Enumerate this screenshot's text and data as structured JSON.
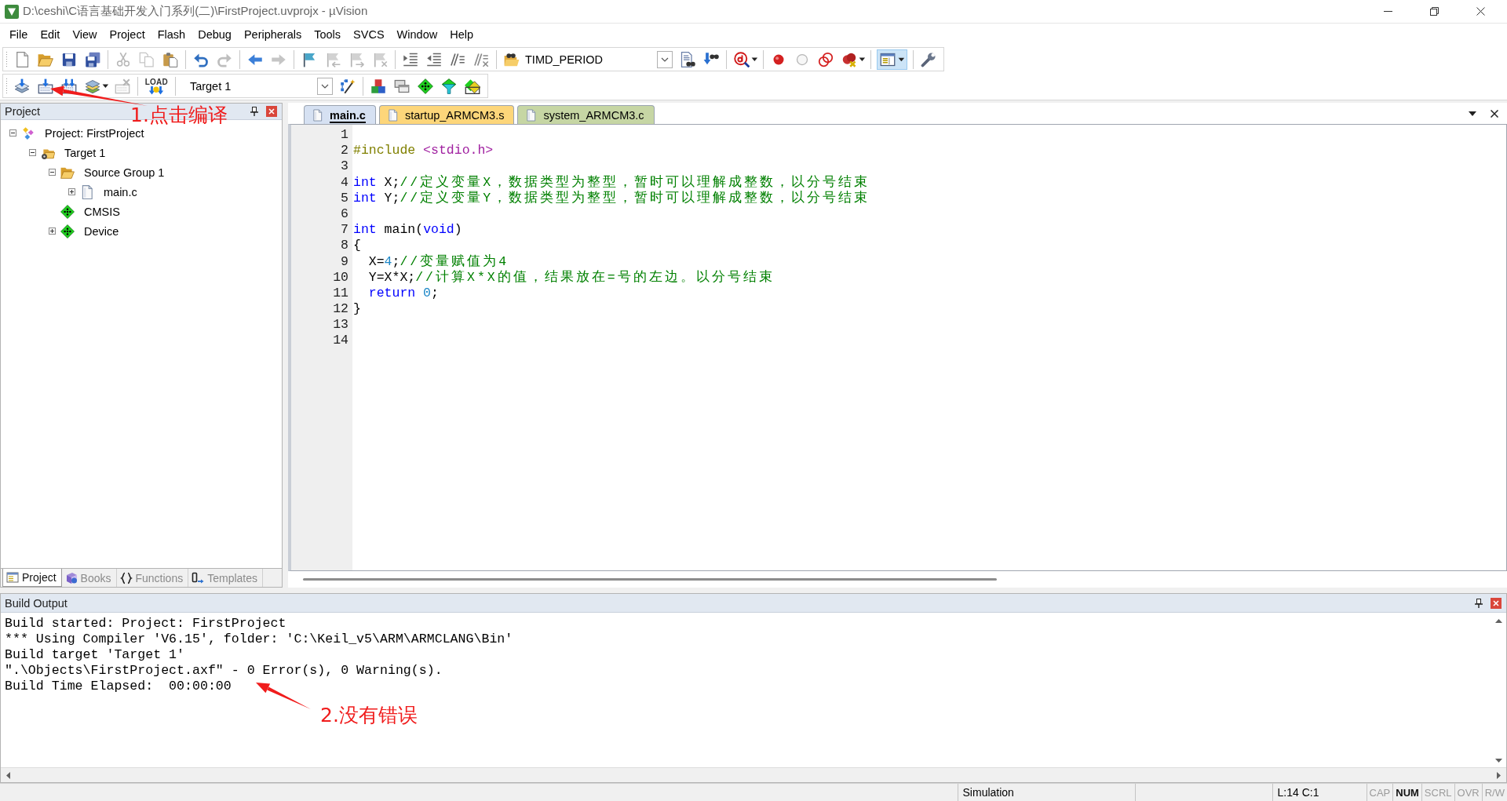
{
  "window": {
    "title": "D:\\ceshi\\C语言基础开发入门系列(二)\\FirstProject.uvprojx - µVision"
  },
  "menu": [
    "File",
    "Edit",
    "View",
    "Project",
    "Flash",
    "Debug",
    "Peripherals",
    "Tools",
    "SVCS",
    "Window",
    "Help"
  ],
  "toolbar_1": [
    {
      "kind": "new",
      "disabled": false,
      "on": false
    },
    {
      "kind": "open",
      "disabled": false,
      "on": false
    },
    {
      "kind": "save",
      "disabled": false,
      "on": false
    },
    {
      "kind": "saveall",
      "disabled": false,
      "on": false
    },
    {
      "kind": "separator"
    },
    {
      "kind": "cut",
      "disabled": true,
      "on": false
    },
    {
      "kind": "copy",
      "disabled": true,
      "on": false
    },
    {
      "kind": "paste",
      "disabled": false,
      "on": false
    },
    {
      "kind": "separator"
    },
    {
      "kind": "undo",
      "disabled": false,
      "on": false
    },
    {
      "kind": "redo",
      "disabled": true,
      "on": false
    },
    {
      "kind": "separator"
    },
    {
      "kind": "back",
      "disabled": false,
      "on": false
    },
    {
      "kind": "forward",
      "disabled": true,
      "on": false
    },
    {
      "kind": "separator"
    },
    {
      "kind": "bookmark",
      "disabled": false,
      "on": false
    },
    {
      "kind": "prevmark",
      "disabled": true,
      "on": false
    },
    {
      "kind": "nextmark",
      "disabled": true,
      "on": false
    },
    {
      "kind": "clearmarks",
      "disabled": true,
      "on": false
    },
    {
      "kind": "separator"
    },
    {
      "kind": "indent",
      "disabled": false,
      "on": false
    },
    {
      "kind": "unindent",
      "disabled": false,
      "on": false
    },
    {
      "kind": "comment",
      "disabled": false,
      "on": false
    },
    {
      "kind": "uncomment",
      "disabled": false,
      "on": false
    },
    {
      "kind": "separator"
    },
    {
      "kind": "findfiles",
      "disabled": false,
      "on": false
    },
    {
      "kind": "combo",
      "value": "TIMD_PERIOD"
    },
    {
      "kind": "find",
      "disabled": false,
      "on": false
    },
    {
      "kind": "incfind",
      "disabled": false,
      "on": false
    },
    {
      "kind": "separator"
    },
    {
      "kind": "debug",
      "disabled": false,
      "on": false
    },
    {
      "kind": "caret",
      "disabled": false,
      "on": false
    },
    {
      "kind": "separator"
    },
    {
      "kind": "breakpoint",
      "disabled": false,
      "on": false
    },
    {
      "kind": "bpdisable",
      "disabled": false,
      "on": false
    },
    {
      "kind": "bpdisableall",
      "disabled": false,
      "on": false
    },
    {
      "kind": "bpkill",
      "disabled": false,
      "on": false
    },
    {
      "kind": "caret",
      "disabled": false,
      "on": false
    },
    {
      "kind": "separator"
    },
    {
      "kind": "layout",
      "disabled": false,
      "on": true
    },
    {
      "kind": "separator"
    },
    {
      "kind": "wrench",
      "disabled": false,
      "on": false
    }
  ],
  "toolbar_2": [
    {
      "kind": "translate",
      "disabled": false,
      "on": false
    },
    {
      "kind": "build",
      "disabled": false,
      "on": false
    },
    {
      "kind": "rebuild",
      "disabled": false,
      "on": false
    },
    {
      "kind": "batch",
      "disabled": false,
      "on": false
    },
    {
      "kind": "caret",
      "disabled": false,
      "on": false
    },
    {
      "kind": "stopbuild",
      "disabled": true,
      "on": false
    },
    {
      "kind": "separator"
    },
    {
      "kind": "load",
      "label": "LOAD",
      "disabled": false,
      "on": false
    },
    {
      "kind": "separator"
    },
    {
      "kind": "combo",
      "value": "Target 1"
    },
    {
      "kind": "wand",
      "disabled": false,
      "on": false
    },
    {
      "kind": "separator"
    },
    {
      "kind": "manage",
      "disabled": false,
      "on": false
    },
    {
      "kind": "windows",
      "disabled": false,
      "on": false
    },
    {
      "kind": "rte",
      "disabled": false,
      "on": false
    },
    {
      "kind": "funnel",
      "disabled": false,
      "on": false
    },
    {
      "kind": "packinstaller",
      "disabled": false,
      "on": false
    }
  ],
  "project_panel": {
    "title": "Project",
    "tree": [
      {
        "label": "Project: FirstProject",
        "kind": "project",
        "expanded": true,
        "selected": false,
        "children": [
          {
            "label": "Target 1",
            "kind": "target",
            "expanded": true,
            "selected": false,
            "children": [
              {
                "label": "Source Group 1",
                "kind": "folder",
                "expanded": true,
                "selected": false,
                "children": [
                  {
                    "label": "main.c",
                    "kind": "file",
                    "expanded": false,
                    "selected": false
                  }
                ]
              },
              {
                "label": "CMSIS",
                "kind": "component",
                "selected": false
              },
              {
                "label": "Device",
                "kind": "component",
                "expanded": false,
                "selected": false
              }
            ]
          }
        ]
      }
    ],
    "tabs": [
      {
        "label": "Project",
        "kind": "project",
        "selected": true
      },
      {
        "label": "Books",
        "kind": "books",
        "selected": false
      },
      {
        "label": "Functions",
        "kind": "functions",
        "selected": false
      },
      {
        "label": "Templates",
        "kind": "templates",
        "selected": false
      }
    ]
  },
  "editor": {
    "tabs": [
      {
        "label": "main.c",
        "selected": true,
        "color": "#d6e1f2"
      },
      {
        "label": "startup_ARMCM3.s",
        "selected": false,
        "color": "#fdd67a"
      },
      {
        "label": "system_ARMCM3.c",
        "selected": false,
        "color": "#c6d6a4"
      }
    ],
    "lines": [
      {
        "number": "1"
      },
      {
        "number": "2",
        "tokens": [
          {
            "kind": "preprocessor",
            "text": "#include"
          },
          {
            "kind": "header",
            "text": " <stdio.h>"
          }
        ]
      },
      {
        "number": "3"
      },
      {
        "number": "4",
        "tokens": [
          {
            "kind": "keyword",
            "text": "int"
          },
          {
            "kind": "plain",
            "text": " X;"
          },
          {
            "kind": "comment",
            "text": "//定义变量X，数据类型为整型，暂时可以理解成整数，以分号结束"
          }
        ]
      },
      {
        "number": "5",
        "tokens": [
          {
            "kind": "keyword",
            "text": "int"
          },
          {
            "kind": "plain",
            "text": " Y;"
          },
          {
            "kind": "comment",
            "text": "//定义变量Y，数据类型为整型，暂时可以理解成整数，以分号结束"
          }
        ]
      },
      {
        "number": "6"
      },
      {
        "number": "7",
        "tokens": [
          {
            "kind": "keyword",
            "text": "int"
          },
          {
            "kind": "plain",
            "text": " main("
          },
          {
            "kind": "keyword",
            "text": "void"
          },
          {
            "kind": "plain",
            "text": ")"
          }
        ]
      },
      {
        "number": "8",
        "tokens": [
          {
            "kind": "plain",
            "text": "{"
          }
        ]
      },
      {
        "number": "9",
        "tokens": [
          {
            "kind": "plain",
            "text": "  X="
          },
          {
            "kind": "number",
            "text": "4"
          },
          {
            "kind": "plain",
            "text": ";"
          },
          {
            "kind": "comment",
            "text": "//变量赋值为4"
          }
        ]
      },
      {
        "number": "10",
        "tokens": [
          {
            "kind": "plain",
            "text": "  Y=X*X;"
          },
          {
            "kind": "comment",
            "text": "//计算X*X的值，结果放在=号的左边。以分号结束"
          }
        ]
      },
      {
        "number": "11",
        "tokens": [
          {
            "kind": "keyword",
            "text": "  return"
          },
          {
            "kind": "number",
            "text": " 0"
          },
          {
            "kind": "plain",
            "text": ";"
          }
        ]
      },
      {
        "number": "12",
        "tokens": [
          {
            "kind": "plain",
            "text": "}"
          }
        ]
      },
      {
        "number": "13"
      },
      {
        "number": "14"
      }
    ]
  },
  "build_output": {
    "title": "Build Output",
    "lines": [
      "Build started: Project: FirstProject",
      "*** Using Compiler 'V6.15', folder: 'C:\\Keil_v5\\ARM\\ARMCLANG\\Bin'",
      "Build target 'Target 1'",
      "\".\\Objects\\FirstProject.axf\" - 0 Error(s), 0 Warning(s).",
      "Build Time Elapsed:  00:00:00"
    ]
  },
  "status_bar": {
    "mode": "Simulation",
    "position": "L:14 C:1",
    "indicators": [
      {
        "label": "CAP",
        "on": false
      },
      {
        "label": "NUM",
        "on": true
      },
      {
        "label": "SCRL",
        "on": false
      },
      {
        "label": "OVR",
        "on": false
      },
      {
        "label": "R/W",
        "on": false
      }
    ]
  },
  "annotations": [
    {
      "text": "1.点击编译"
    },
    {
      "text": "2.没有错误"
    }
  ]
}
